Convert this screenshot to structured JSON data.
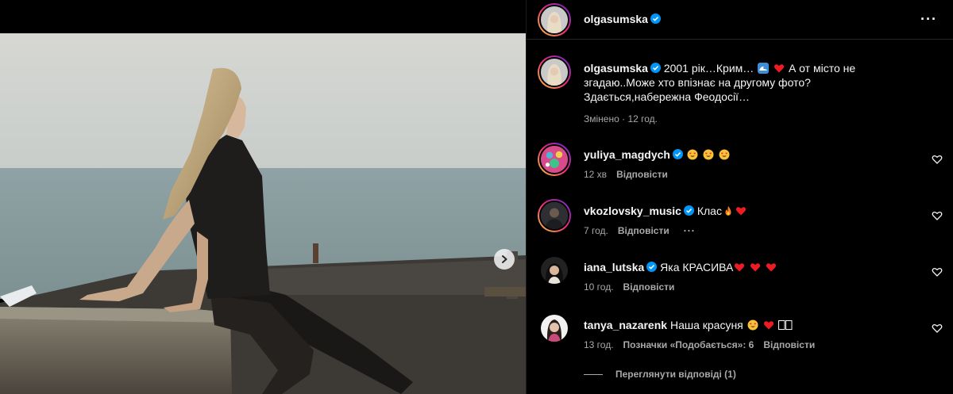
{
  "post": {
    "author": "olgasumska",
    "author_verified": true,
    "more_icon": "more-horizontal-icon",
    "next_icon": "chevron-right-icon"
  },
  "caption": {
    "username": "olgasumska",
    "text_part1": "2001 рік…Крим…",
    "text_part2": "А от місто не згадаю..Може хто впізнає на другому фото? Здається,набережна Феодосії…",
    "edited": "Змінено",
    "separator": "·",
    "time": "12 год."
  },
  "comments": [
    {
      "username": "yuliya_magdych",
      "verified": true,
      "text": "",
      "time": "12 хв",
      "reply": "Відповісти",
      "likes": "",
      "emoji": "heart-eyes x3"
    },
    {
      "username": "vkozlovsky_music",
      "verified": true,
      "text": "Клас",
      "time": "7 год.",
      "reply": "Відповісти",
      "likes": "",
      "emoji": "fire, heart"
    },
    {
      "username": "iana_lutska",
      "verified": true,
      "text": "Яка КРАСИВА",
      "time": "10 год.",
      "reply": "Відповісти",
      "likes": "",
      "emoji": "heart x3"
    },
    {
      "username": "tanya_nazarenk",
      "verified": false,
      "text": "Наша красуня",
      "time": "13 год.",
      "reply": "Відповісти",
      "likes": "Позначки «Подобається»: 6",
      "emoji": "heart-eyes, heart, flag"
    }
  ],
  "view_replies": "Переглянути відповіді (1)",
  "colors": {
    "background": "#000000",
    "text": "#f5f5f5",
    "muted": "#a8a8a8",
    "verified": "#0095f6",
    "heart": "#ed1c24"
  }
}
